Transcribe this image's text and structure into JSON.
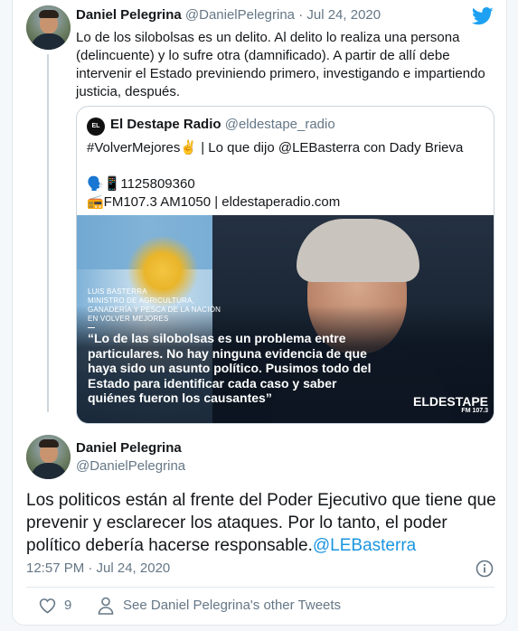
{
  "reply_tweet": {
    "author_name": "Daniel Pelegrina",
    "author_handle": "@DanielPelegrina",
    "separator": "·",
    "date": "Jul 24, 2020",
    "text": "Lo de los silobolsas es un delito. Al delito lo realiza una persona (delincuente) y lo sufre otra (damnificado). A partir de allí debe intervenir el Estado previniendo primero, investigando e impartiendo justicia, después."
  },
  "quoted_tweet": {
    "avatar_text": "EL DESTAPE",
    "author_name": "El Destape Radio",
    "author_handle": "@eldestape_radio",
    "lines": [
      "#VolverMejores✌️ | Lo que dijo @LEBasterra con Dady Brieva",
      "",
      "🗣️📱1125809360",
      "📻FM107.3 AM1050 | eldestaperadio.com"
    ],
    "image": {
      "caption_lines": [
        "Luis Basterra",
        "Ministro de Agricultura,",
        "Ganadería y Pesca de la Nación",
        "en Volver Mejores"
      ],
      "quote_lines": [
        "“Lo de las silobolsas es un problema entre",
        "particulares. No hay ninguna evidencia de que",
        "haya sido un asunto político. Pusimos todo del",
        "Estado para identificar cada caso y saber",
        "quiénes fueron los causantes”"
      ],
      "brand_main": "ELDESTAPE",
      "brand_sub": "FM 107.3"
    }
  },
  "main_tweet": {
    "author_name": "Daniel Pelegrina",
    "author_handle": "@DanielPelegrina",
    "text_lines": [
      "Los politicos están al frente del Poder Ejecutivo que tiene que",
      "prevenir y esclarecer los ataques. Por lo tanto, el poder",
      "político debería hacerse responsable."
    ],
    "mention": "@LEBasterra",
    "timestamp": "12:57 PM · Jul 24, 2020",
    "like_count": "9",
    "see_other_tweets": "See Daniel Pelegrina's other Tweets"
  },
  "colors": {
    "twitter_blue": "#1da1f2",
    "link": "#1b95e0",
    "muted": "#657786",
    "border": "#e1e8ed"
  },
  "icons": [
    "twitter-bird-icon",
    "info-icon",
    "heart-icon",
    "person-icon"
  ]
}
